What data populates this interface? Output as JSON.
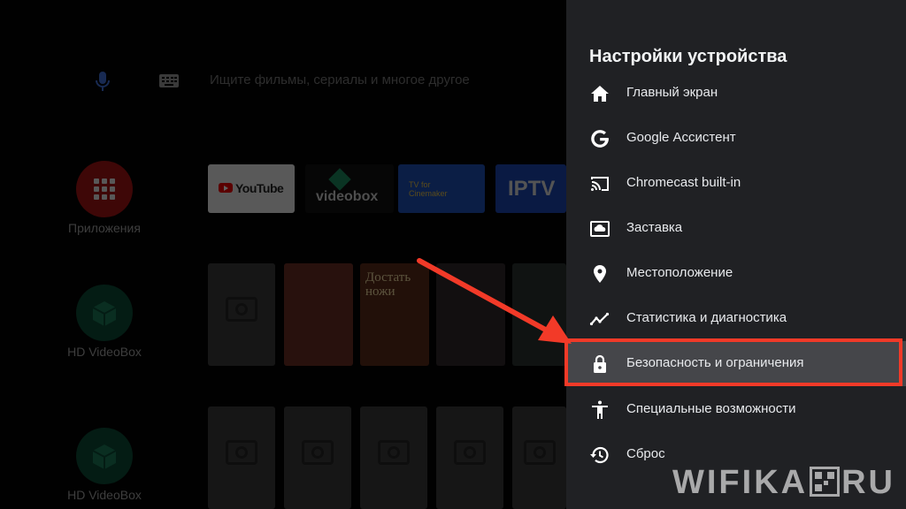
{
  "launcher": {
    "search_placeholder": "Ищите фильмы, сериалы и многое другое",
    "side_apps": [
      {
        "label": "Приложения"
      },
      {
        "label": "HD VideoBox"
      },
      {
        "label": "HD VideoBox"
      }
    ],
    "tiles": {
      "youtube": "YouTube",
      "videobox": "videobox",
      "tv_line1": "TV for",
      "tv_line2": "Cinemaker",
      "iptv": "IPTV",
      "poster_text": "Достать ножи"
    }
  },
  "settings": {
    "title": "Настройки устройства",
    "items": [
      {
        "label": "Главный экран",
        "icon": "home-icon"
      },
      {
        "label": "Google Ассистент",
        "icon": "google-icon"
      },
      {
        "label": "Chromecast built-in",
        "icon": "cast-icon"
      },
      {
        "label": "Заставка",
        "icon": "screensaver-icon"
      },
      {
        "label": "Местоположение",
        "icon": "location-pin-icon"
      },
      {
        "label": "Статистика и диагностика",
        "icon": "stats-icon"
      },
      {
        "label": "Безопасность и ограничения",
        "icon": "lock-icon",
        "selected": true
      },
      {
        "label": "Специальные возможности",
        "icon": "accessibility-icon"
      },
      {
        "label": "Сброс",
        "icon": "reset-icon"
      }
    ]
  },
  "annotation": {
    "highlight_color": "#f23a28"
  },
  "watermark": {
    "left": "WIFIKA",
    "right": "RU"
  }
}
